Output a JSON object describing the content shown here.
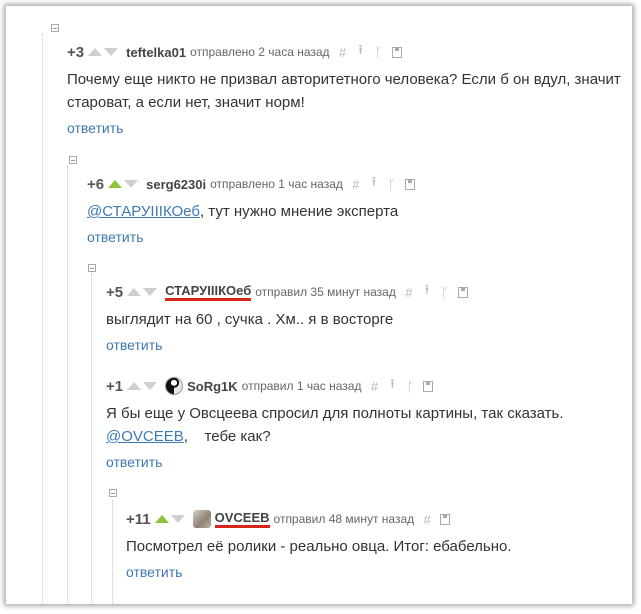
{
  "comments": [
    {
      "rating": "+3",
      "username": "teftelka01",
      "time": "отправлено 2 часа назад",
      "text": "Почему еще никто не призвал авторитетного человека? Если б он вдул, значит староват, а если нет, значит норм!",
      "reply": "ответить"
    },
    {
      "rating": "+6",
      "username": "serg6230i",
      "time": "отправлено 1 час назад",
      "mention": "@СТАРУIIIКОеб",
      "text": ", тут нужно мнение эксперта",
      "reply": "ответить"
    },
    {
      "rating": "+5",
      "username": "СТАРУIIIКОеб",
      "time": "отправил 35 минут назад",
      "text": "выглядит на 60 , сучка . Хм.. я в восторге",
      "reply": "ответить"
    },
    {
      "rating": "+1",
      "username": "SoRg1K",
      "time": "отправил 1 час назад",
      "text": "Я бы еще у Овсцеева спросил для полноты картины, так сказать.",
      "mention": "@OVCEEB",
      "text2": ",    тебе как?",
      "reply": "ответить"
    },
    {
      "rating": "+11",
      "username": "OVCEEB",
      "time": "отправил 48 минут назад",
      "text": "Посмотрел её ролики - реально овца. Итог: ебабельно.",
      "reply": "ответить"
    }
  ],
  "icons": {
    "hash": "#",
    "up_arrow": "⭱",
    "branch": "ᚴ"
  },
  "colors": {
    "accent_link": "#3d79b3",
    "upvote_active": "#8cc43b",
    "highlight_underline": "#d9231d"
  }
}
